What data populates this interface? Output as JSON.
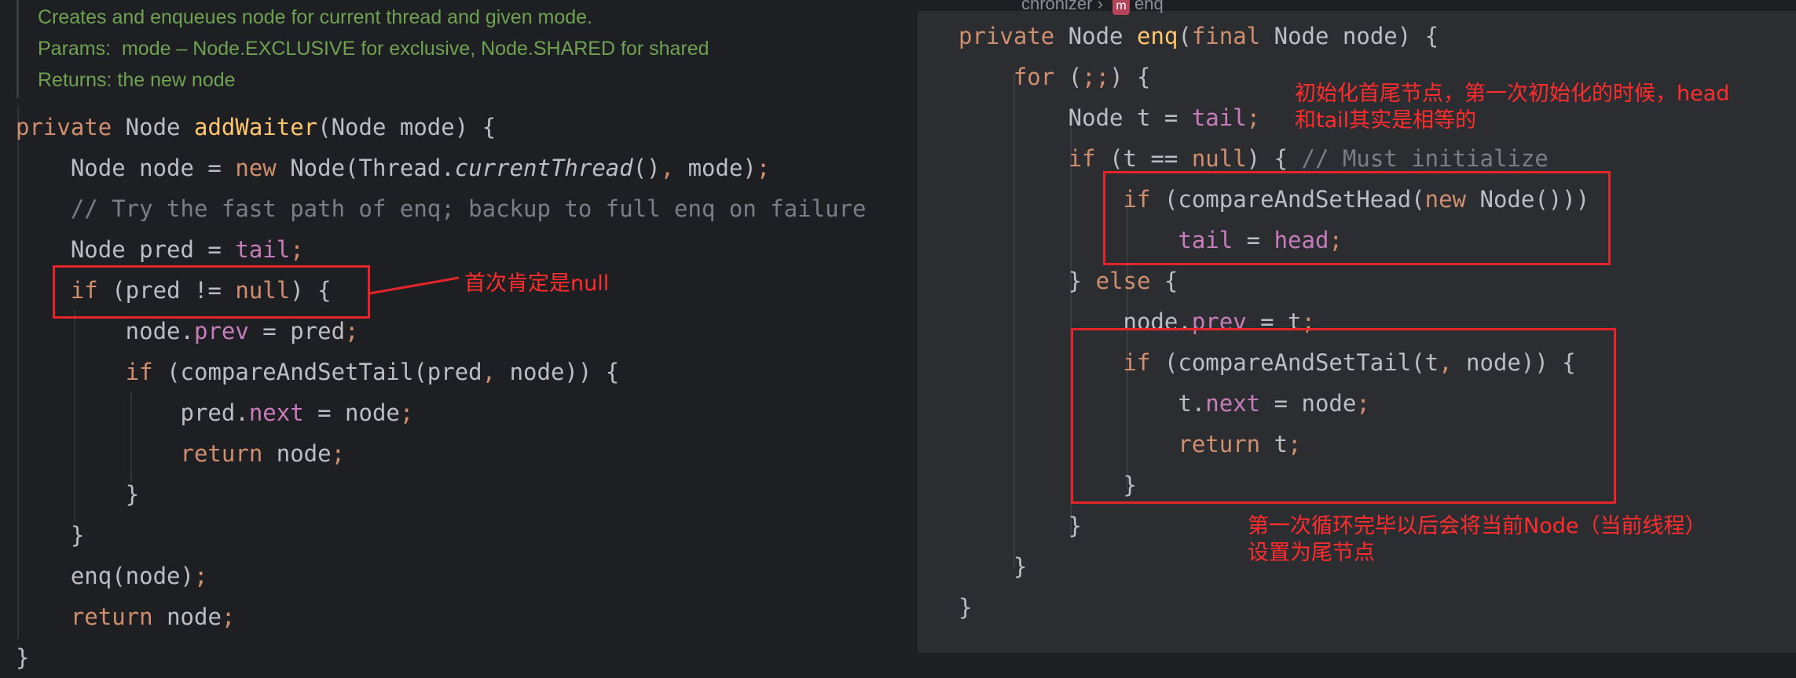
{
  "doc_comment": {
    "line1": "Creates and enqueues node for current thread and given mode.",
    "line2": "Params:  mode – Node.EXCLUSIVE for exclusive, Node.SHARED for shared",
    "line3": "Returns: the new node"
  },
  "left_code": [
    "private Node addWaiter(Node mode) {",
    "    Node node = new Node(Thread.currentThread(), mode);",
    "    // Try the fast path of enq; backup to full enq on failure",
    "    Node pred = tail;",
    "    if (pred != null) {",
    "        node.prev = pred;",
    "        if (compareAndSetTail(pred, node)) {",
    "            pred.next = node;",
    "            return node;",
    "        }",
    "    }",
    "    enq(node);",
    "    return node;",
    "}"
  ],
  "right_code": [
    "private Node enq(final Node node) {",
    "    for (;;) {",
    "        Node t = tail;",
    "        if (t == null) { // Must initialize",
    "            if (compareAndSetHead(new Node()))",
    "                tail = head;",
    "        } else {",
    "            node.prev = t;",
    "            if (compareAndSetTail(t, node)) {",
    "                t.next = node;",
    "                return t;",
    "            }",
    "        }",
    "    }",
    "}"
  ],
  "breadcrumb": {
    "left": "chronizer",
    "method": "enq",
    "method_badge": "m"
  },
  "annotations": {
    "null_note": "首次肯定是null",
    "init_note_line1": "初始化首尾节点，第一次初始化的时候，head",
    "init_note_line2": "和tail其实是相等的",
    "tail_note_line1": "第一次循环完毕以后会将当前Node（当前线程）",
    "tail_note_line2": "设置为尾节点"
  },
  "colors": {
    "annotation_red": "#e5252a",
    "keyword": "#cf8e6d",
    "method_decl": "#ffc66d",
    "field": "#c77dbb",
    "comment": "#7a7e85",
    "doc_comment": "#6ea252"
  }
}
